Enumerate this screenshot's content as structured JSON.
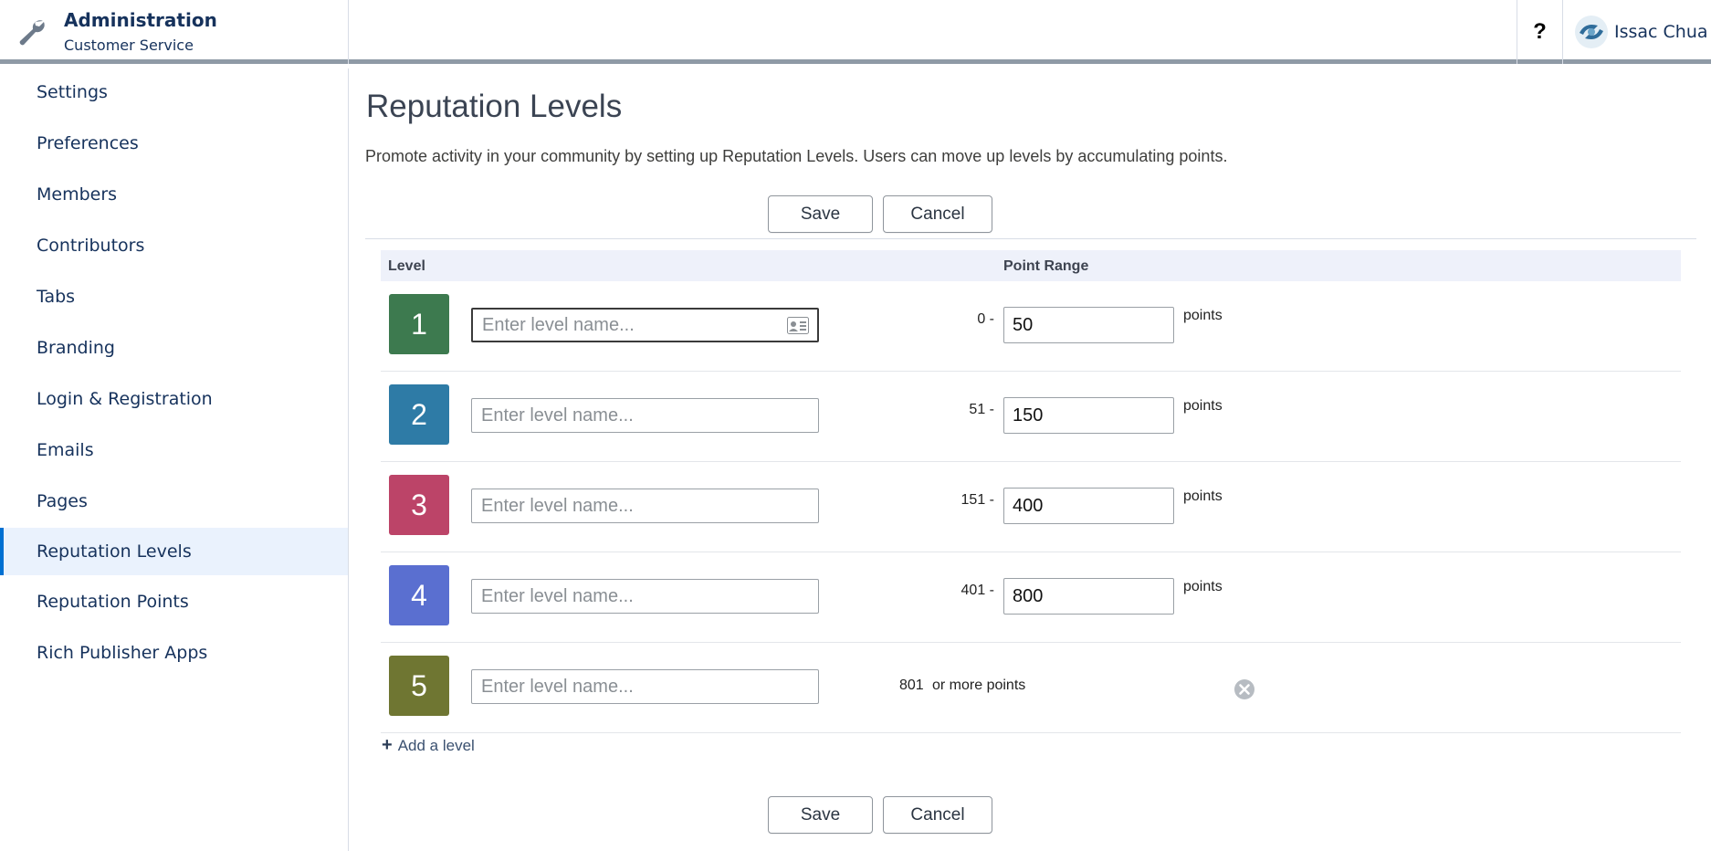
{
  "header": {
    "app_title": "Administration",
    "app_subtitle": "Customer Service",
    "help_label": "?",
    "user_name": "Issac Chua"
  },
  "sidebar": {
    "items": [
      {
        "label": "Settings"
      },
      {
        "label": "Preferences"
      },
      {
        "label": "Members"
      },
      {
        "label": "Contributors"
      },
      {
        "label": "Tabs"
      },
      {
        "label": "Branding"
      },
      {
        "label": "Login & Registration"
      },
      {
        "label": "Emails"
      },
      {
        "label": "Pages"
      },
      {
        "label": "Reputation Levels",
        "active": true
      },
      {
        "label": "Reputation Points"
      },
      {
        "label": "Rich Publisher Apps"
      }
    ]
  },
  "main": {
    "title": "Reputation Levels",
    "description": "Promote activity in your community by setting up Reputation Levels. Users can move up levels by accumulating points.",
    "save_label": "Save",
    "cancel_label": "Cancel",
    "columns": {
      "level": "Level",
      "point_range": "Point Range"
    },
    "name_placeholder": "Enter level name...",
    "points_suffix": "points",
    "levels": [
      {
        "number": "1",
        "color": "#3d7a4f",
        "range_start": "0 -",
        "points_value": "50"
      },
      {
        "number": "2",
        "color": "#2e7ba6",
        "range_start": "51 -",
        "points_value": "150"
      },
      {
        "number": "3",
        "color": "#bc4468",
        "range_start": "151 -",
        "points_value": "400"
      },
      {
        "number": "4",
        "color": "#5a6fd0",
        "range_start": "401 -",
        "points_value": "800"
      },
      {
        "number": "5",
        "color": "#6f7632",
        "range_start": "801",
        "more_label": "or more points"
      }
    ],
    "add_level_label": "Add a level"
  },
  "colors": {
    "accent": "#0070d2",
    "active_nav_bg": "#eaf2fd",
    "header_border": "#8f9aa6"
  }
}
